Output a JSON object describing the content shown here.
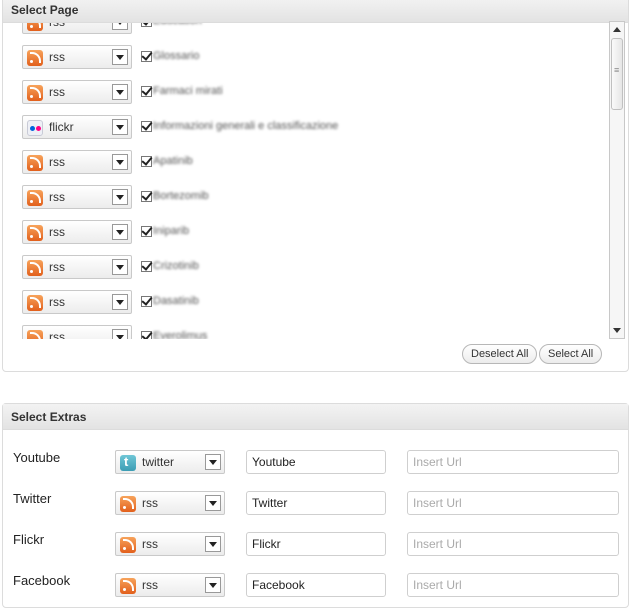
{
  "select_page": {
    "title": "Select Page",
    "rows": [
      {
        "type": "rss",
        "label": "rss",
        "page": "Education"
      },
      {
        "type": "rss",
        "label": "rss",
        "page": "Glossario"
      },
      {
        "type": "rss",
        "label": "rss",
        "page": "Farmaci mirati"
      },
      {
        "type": "flickr",
        "label": "flickr",
        "page": "Informazioni generali e classificazione"
      },
      {
        "type": "rss",
        "label": "rss",
        "page": "Apatinib"
      },
      {
        "type": "rss",
        "label": "rss",
        "page": "Bortezomib"
      },
      {
        "type": "rss",
        "label": "rss",
        "page": "Iniparib"
      },
      {
        "type": "rss",
        "label": "rss",
        "page": "Crizotinib"
      },
      {
        "type": "rss",
        "label": "rss",
        "page": "Dasatinib"
      },
      {
        "type": "rss",
        "label": "rss",
        "page": "Everolimus"
      }
    ],
    "deselect_all": "Deselect All",
    "select_all": "Select All"
  },
  "select_extras": {
    "title": "Select Extras",
    "rows": [
      {
        "label": "Youtube",
        "type": "twitter",
        "select": "twitter",
        "name": "Youtube",
        "url_placeholder": "Insert Url"
      },
      {
        "label": "Twitter",
        "type": "rss",
        "select": "rss",
        "name": "Twitter",
        "url_placeholder": "Insert Url"
      },
      {
        "label": "Flickr",
        "type": "rss",
        "select": "rss",
        "name": "Flickr",
        "url_placeholder": "Insert Url"
      },
      {
        "label": "Facebook",
        "type": "rss",
        "select": "rss",
        "name": "Facebook",
        "url_placeholder": "Insert Url"
      }
    ]
  }
}
